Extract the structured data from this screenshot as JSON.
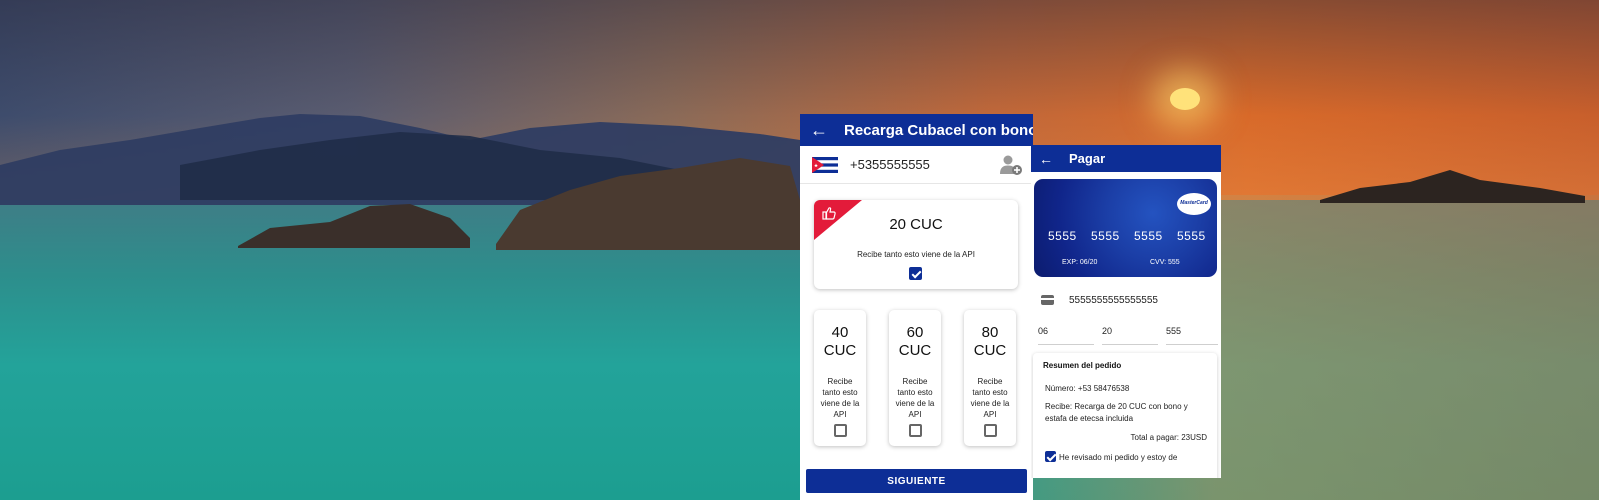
{
  "recharge_screen": {
    "title": "Recarga Cubacel con bono",
    "phone_number": "+5355555555",
    "featured": {
      "amount": "20 CUC",
      "description": "Recibe tanto esto viene de la API",
      "checked": true
    },
    "options": [
      {
        "amount_num": "40",
        "currency": "CUC",
        "description": [
          "Recibe",
          "tanto esto",
          "viene de la",
          "API"
        ],
        "checked": false
      },
      {
        "amount_num": "60",
        "currency": "CUC",
        "description": [
          "Recibe",
          "tanto esto",
          "viene de la",
          "API"
        ],
        "checked": false
      },
      {
        "amount_num": "80",
        "currency": "CUC",
        "description": [
          "Recibe",
          "tanto esto",
          "viene de la",
          "API"
        ],
        "checked": false
      }
    ],
    "next_button": "SIGUIENTE"
  },
  "pay_screen": {
    "title": "Pagar",
    "card": {
      "brand": "MasterCard",
      "groups": [
        "5555",
        "5555",
        "5555",
        "5555"
      ],
      "exp": "EXP: 06/20",
      "cvv": "CVV: 555"
    },
    "card_number_field": "5555555555555555",
    "month_field": "06",
    "year_field": "20",
    "cvv_field": "555",
    "summary": {
      "title": "Resumen del pedido",
      "number_line": "Número: +53 58476538",
      "receive_line1": "Recibe: Recarga de 20 CUC con bono y",
      "receive_line2": "estafa de etecsa incluida",
      "total": "Total a pagar: 23USD",
      "agree_text": "He revisado mi pedido y estoy de",
      "agree_checked": true
    }
  },
  "colors": {
    "primary": "#0d2e96",
    "ribbon": "#e31b3a"
  }
}
